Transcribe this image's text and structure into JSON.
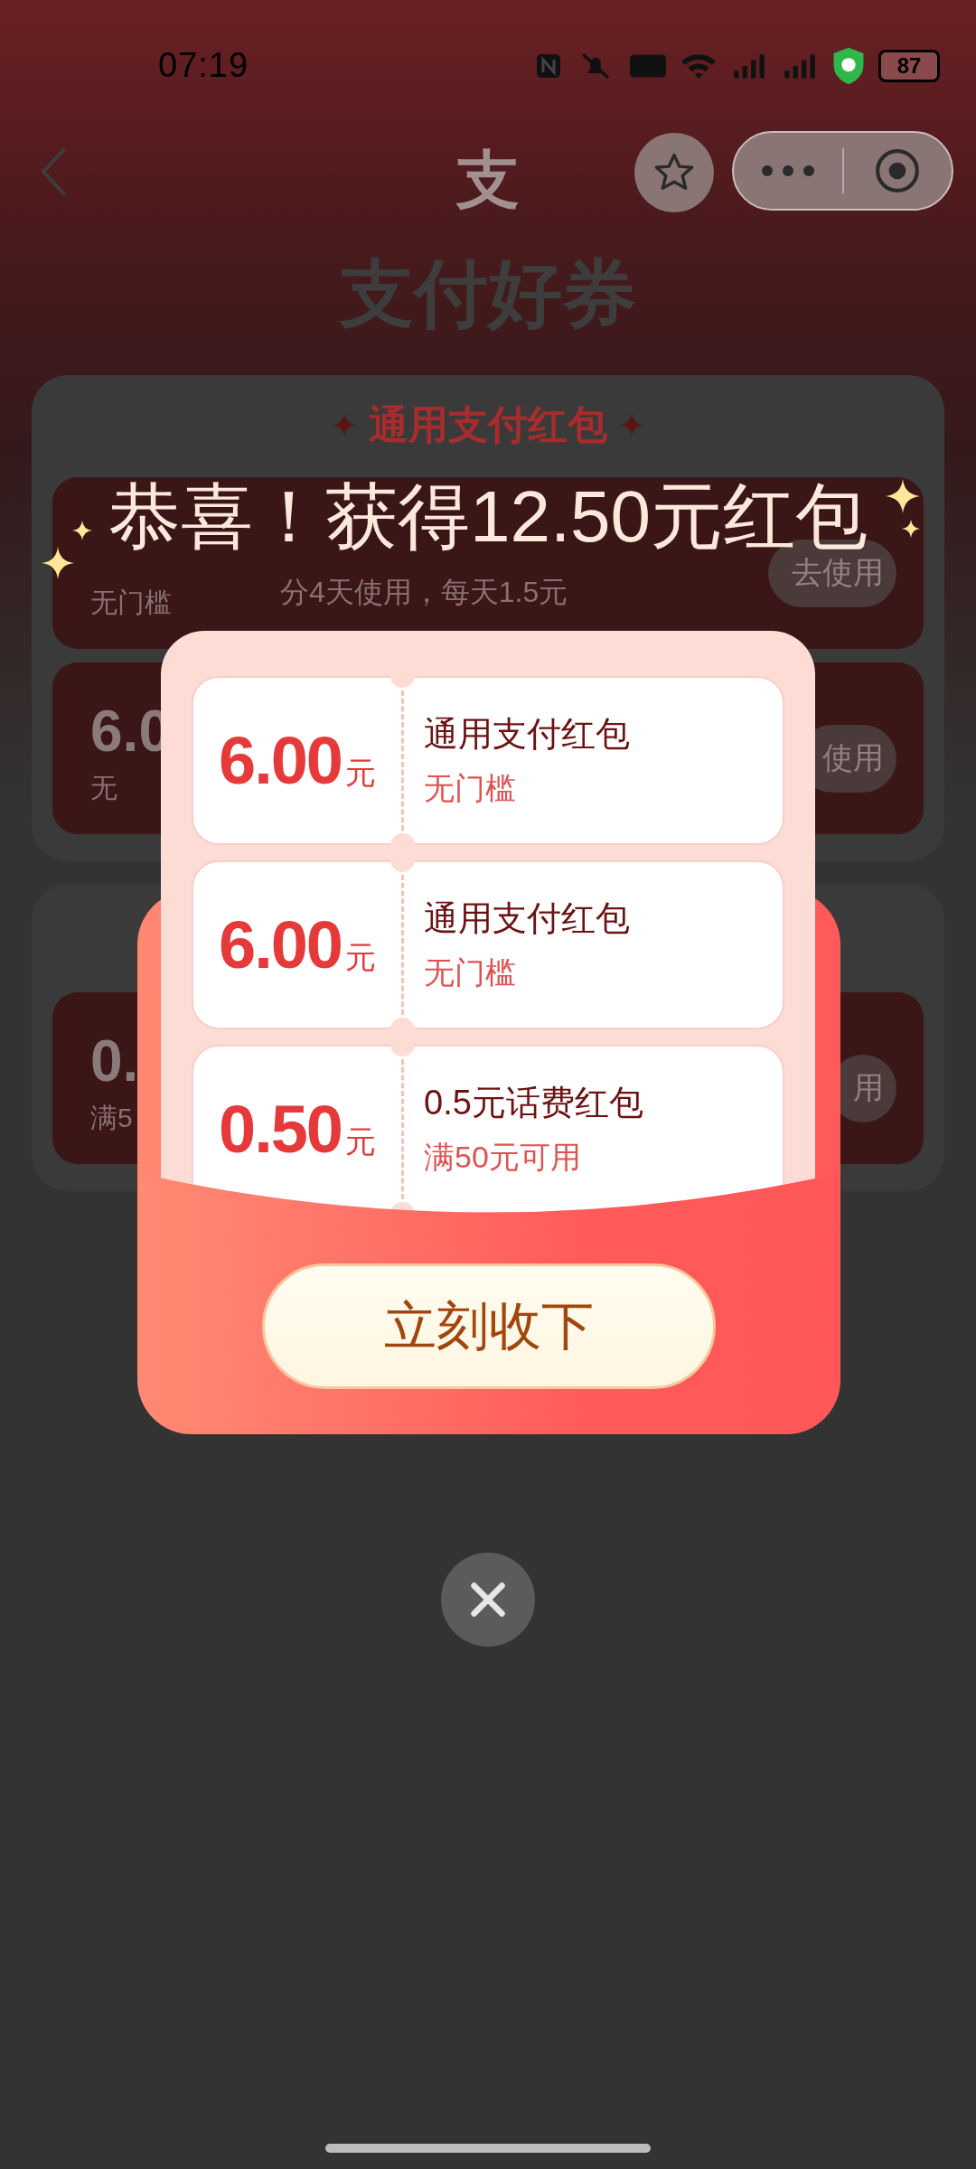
{
  "status_bar": {
    "time": "07:19",
    "battery": "87"
  },
  "nav": {
    "logo": "支"
  },
  "page_title": "支付好券",
  "sections": [
    {
      "title": "通用支付红包",
      "coupons": [
        {
          "condition": "无门槛",
          "detail": "分4天使用，每天1.5元",
          "button": "去使用"
        },
        {
          "amount": "6.0",
          "condition": "无",
          "button": "使用"
        }
      ]
    },
    {
      "coupons": [
        {
          "amount": "0.",
          "condition": "满5",
          "button": "用"
        }
      ]
    }
  ],
  "popup": {
    "title": "恭喜！获得12.50元红包",
    "coupons": [
      {
        "amount": "6.00",
        "unit": "元",
        "name": "通用支付红包",
        "condition": "无门槛"
      },
      {
        "amount": "6.00",
        "unit": "元",
        "name": "通用支付红包",
        "condition": "无门槛"
      },
      {
        "amount": "0.50",
        "unit": "元",
        "name": "0.5元话费红包",
        "condition": "满50元可用"
      }
    ],
    "accept_button": "立刻收下"
  }
}
